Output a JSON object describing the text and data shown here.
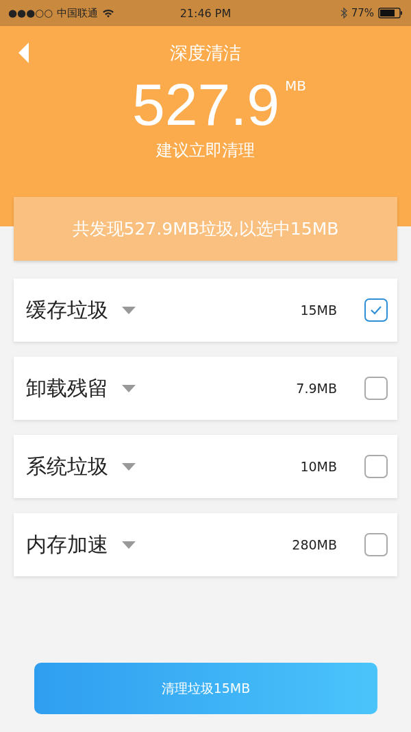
{
  "status_bar": {
    "signal": "●●●○○",
    "carrier": "中国联通",
    "time": "21:46 PM",
    "battery": "77%"
  },
  "header": {
    "title": "深度清洁",
    "size": "527.9",
    "unit": "MB",
    "advice": "建议立即清理"
  },
  "summary": "共发现527.9MB垃圾,以选中15MB",
  "items": [
    {
      "label": "缓存垃圾",
      "size": "15MB",
      "checked": true
    },
    {
      "label": "卸载残留",
      "size": "7.9MB",
      "checked": false
    },
    {
      "label": "系统垃圾",
      "size": "10MB",
      "checked": false
    },
    {
      "label": "内存加速",
      "size": "280MB",
      "checked": false
    }
  ],
  "clean_button": "清理垃圾15MB"
}
